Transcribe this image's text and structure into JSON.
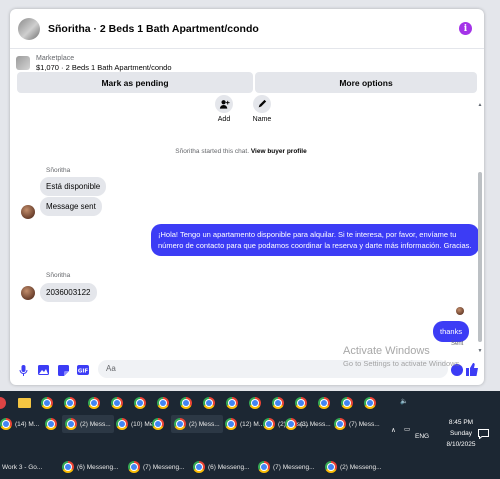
{
  "chat": {
    "title": "Sñoritha · 2 Beds 1 Bath Apartment/condo",
    "info_icon": "info-icon",
    "listing": {
      "label": "Marketplace",
      "price_title": "$1,070 · 2 Beds 1 Bath Apartment/condo"
    },
    "actions": {
      "mark_pending": "Mark as pending",
      "more_options": "More options"
    },
    "shortcuts": [
      {
        "label": "Add",
        "icon": "add-person-icon"
      },
      {
        "label": "Name",
        "icon": "pencil-icon"
      }
    ],
    "system_note": {
      "text": "Sñoritha started this chat.",
      "link": "View buyer profile"
    },
    "messages": [
      {
        "sender": "Sñoritha",
        "text": "Está disponible",
        "direction": "in"
      },
      {
        "text": "Message sent",
        "direction": "in"
      },
      {
        "text": "¡Hola! Tengo un apartamento disponible para alquilar. Si te interesa, por favor, envíame tu número de contacto para que podamos coordinar la reserva y darte más información. Gracias.",
        "direction": "out"
      },
      {
        "sender": "Sñoritha",
        "text": "2036003122",
        "direction": "in"
      },
      {
        "text": "thanks",
        "direction": "out"
      }
    ],
    "sent_status": "Sent",
    "composer": {
      "placeholder": "Aa",
      "icons": [
        "microphone-icon",
        "photo-icon",
        "sticker-icon",
        "gif-icon"
      ],
      "emoji_icon": "emoji-icon",
      "like_icon": "thumbs-up-icon"
    },
    "colors": {
      "accent": "#3c3cf5",
      "info": "#a433e8",
      "bubble_in": "#e4e6eb"
    }
  },
  "watermark": {
    "title": "Activate Windows",
    "subtitle": "Go to Settings to activate Windows."
  },
  "taskbar": {
    "row2": [
      {
        "label": "(14) M..."
      },
      {
        "label": "(2) Mess..."
      },
      {
        "label": "(10) Me..."
      },
      {
        "label": "(2) Mess..."
      },
      {
        "label": "(12) M..."
      },
      {
        "label": "(2) Mess..."
      },
      {
        "label": "(3) Mess..."
      },
      {
        "label": "(7) Mess..."
      }
    ],
    "row3": [
      {
        "label": "Work 3 - Go..."
      },
      {
        "label": "(6) Messeng..."
      },
      {
        "label": "(7) Messeng..."
      },
      {
        "label": "(6) Messeng..."
      },
      {
        "label": "(7) Messeng..."
      },
      {
        "label": "(2) Messeng..."
      }
    ],
    "language": "ENG",
    "time": "8:45 PM",
    "day": "Sunday",
    "date": "8/10/2025"
  }
}
